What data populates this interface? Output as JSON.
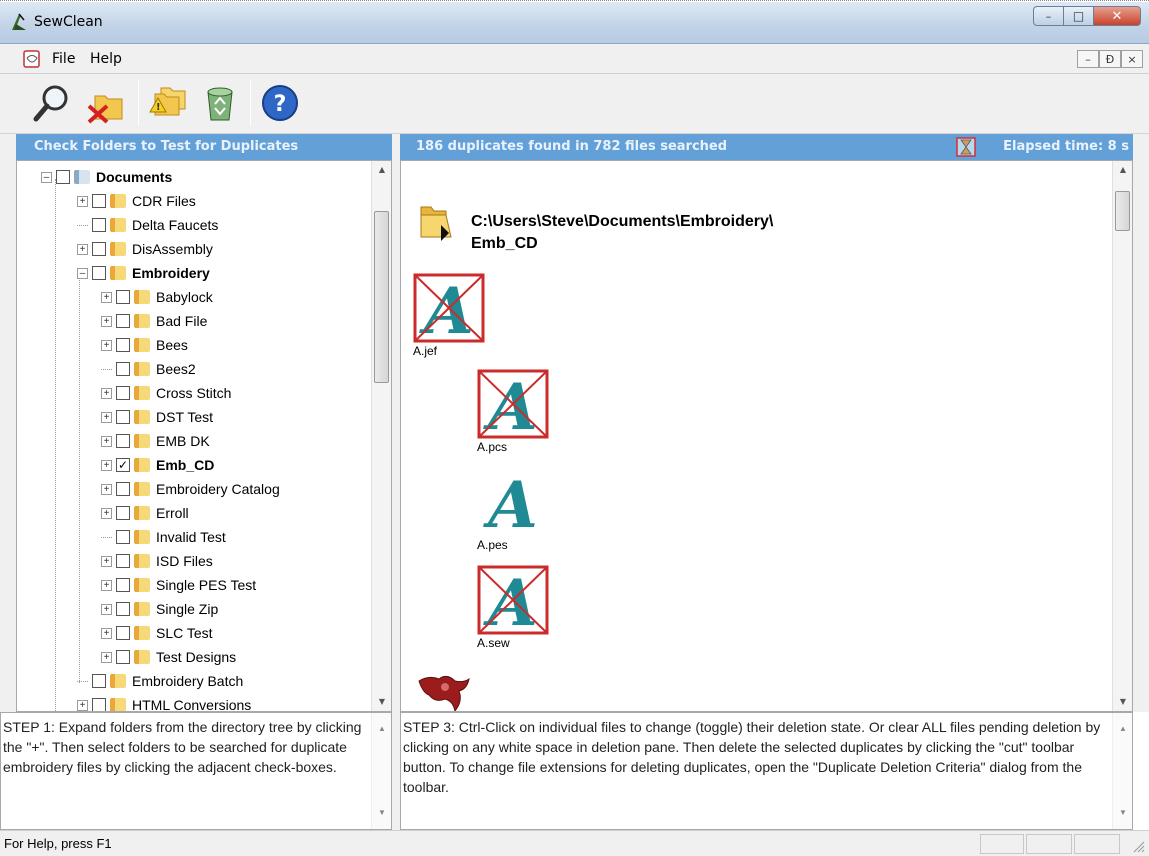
{
  "window": {
    "title": "SewClean",
    "minimize": "–",
    "maximize": "□",
    "close": "✕"
  },
  "menu": {
    "items": [
      "File",
      "Help"
    ],
    "mdi": [
      "–",
      "Ɖ",
      "×"
    ]
  },
  "toolbar": {
    "buttons": [
      "search-icon",
      "cut-folder-icon",
      "criteria-folders-icon",
      "recycle-bin-icon",
      "help-icon"
    ]
  },
  "left_panel": {
    "header": "Check Folders to Test for Duplicates",
    "tree": [
      {
        "label": "Documents",
        "level": 0,
        "bold": true,
        "checked": false,
        "expander": "–"
      },
      {
        "label": "CDR Files",
        "level": 1,
        "bold": false,
        "checked": false,
        "expander": "+"
      },
      {
        "label": "Delta Faucets",
        "level": 1,
        "bold": false,
        "checked": false,
        "expander": ""
      },
      {
        "label": "DisAssembly",
        "level": 1,
        "bold": false,
        "checked": false,
        "expander": "+"
      },
      {
        "label": "Embroidery",
        "level": 1,
        "bold": true,
        "checked": false,
        "expander": "–"
      },
      {
        "label": "Babylock",
        "level": 2,
        "bold": false,
        "checked": false,
        "expander": "+"
      },
      {
        "label": "Bad File",
        "level": 2,
        "bold": false,
        "checked": false,
        "expander": "+"
      },
      {
        "label": "Bees",
        "level": 2,
        "bold": false,
        "checked": false,
        "expander": "+"
      },
      {
        "label": "Bees2",
        "level": 2,
        "bold": false,
        "checked": false,
        "expander": ""
      },
      {
        "label": "Cross Stitch",
        "level": 2,
        "bold": false,
        "checked": false,
        "expander": "+"
      },
      {
        "label": "DST Test",
        "level": 2,
        "bold": false,
        "checked": false,
        "expander": "+"
      },
      {
        "label": "EMB DK",
        "level": 2,
        "bold": false,
        "checked": false,
        "expander": "+"
      },
      {
        "label": "Emb_CD",
        "level": 2,
        "bold": true,
        "checked": true,
        "expander": "+"
      },
      {
        "label": "Embroidery Catalog",
        "level": 2,
        "bold": false,
        "checked": false,
        "expander": "+"
      },
      {
        "label": "Erroll",
        "level": 2,
        "bold": false,
        "checked": false,
        "expander": "+"
      },
      {
        "label": "Invalid Test",
        "level": 2,
        "bold": false,
        "checked": false,
        "expander": ""
      },
      {
        "label": "ISD Files",
        "level": 2,
        "bold": false,
        "checked": false,
        "expander": "+"
      },
      {
        "label": "Single PES Test",
        "level": 2,
        "bold": false,
        "checked": false,
        "expander": "+"
      },
      {
        "label": "Single Zip",
        "level": 2,
        "bold": false,
        "checked": false,
        "expander": "+"
      },
      {
        "label": "SLC Test",
        "level": 2,
        "bold": false,
        "checked": false,
        "expander": "+"
      },
      {
        "label": "Test Designs",
        "level": 2,
        "bold": false,
        "checked": false,
        "expander": "+"
      },
      {
        "label": "Embroidery Batch",
        "level": 1,
        "bold": false,
        "checked": false,
        "expander": ""
      },
      {
        "label": "HTML Conversions",
        "level": 1,
        "bold": false,
        "checked": false,
        "expander": "+"
      }
    ],
    "step_text": "STEP 1: Expand folders from the directory tree by clicking the \"+\". Then select folders to be searched for duplicate embroidery files by clicking the adjacent check-boxes."
  },
  "right_panel": {
    "status": "186 duplicates found in 782 files searched",
    "elapsed": "Elapsed time: 8 s",
    "path_line1": "C:\\Users\\Steve\\Documents\\Embroidery\\",
    "path_line2": "Emb_CD",
    "files": [
      {
        "name": "A.jef",
        "marked": true
      },
      {
        "name": "A.pcs",
        "marked": true
      },
      {
        "name": "A.pes",
        "marked": false
      },
      {
        "name": "A.sew",
        "marked": true
      }
    ],
    "step_text": "STEP 3: Ctrl-Click on individual files to change (toggle) their deletion state. Or clear ALL files pending deletion by clicking on any white space in deletion pane. Then delete the selected duplicates by clicking the \"cut\" toolbar button. To change file extensions for deleting duplicates, open the \"Duplicate Deletion Criteria\" dialog from the toolbar."
  },
  "statusbar": {
    "message": "For Help, press F1"
  },
  "colors": {
    "header_bg": "#64a0d8",
    "deleted_mark": "#cc2b2b",
    "design_teal": "#1f8a93"
  }
}
